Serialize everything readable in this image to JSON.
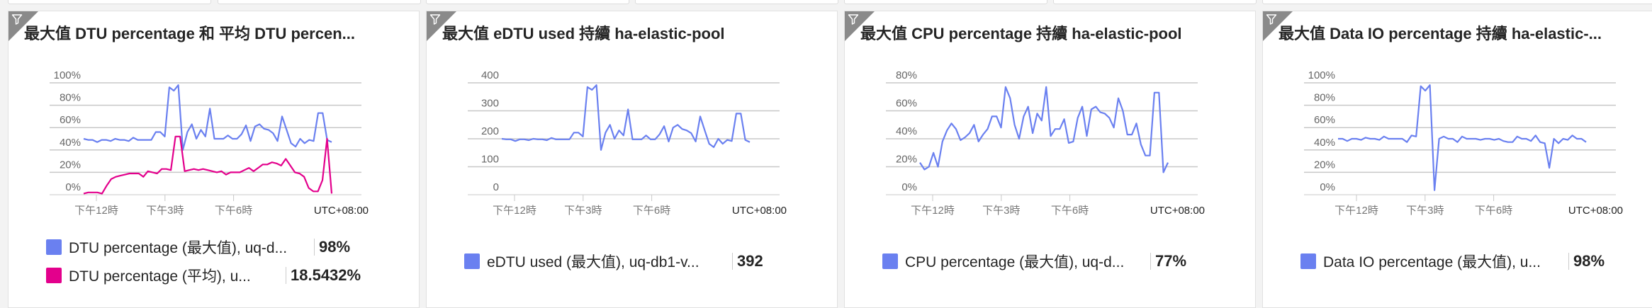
{
  "colors": {
    "blue": "#6a80f0",
    "magenta": "#e3008c",
    "grid": "#c8c8c8"
  },
  "panels": [
    {
      "title": "最大值 DTU percentage 和 平均 DTU percen...",
      "filter_icon": "funnel-icon",
      "chart_data": {
        "type": "line",
        "title": "最大值 DTU percentage 和 平均 DTU percen...",
        "ylim": [
          0,
          100
        ],
        "y_ticks": [
          {
            "v": 0,
            "label": "0%"
          },
          {
            "v": 20,
            "label": "20%"
          },
          {
            "v": 40,
            "label": "40%"
          },
          {
            "v": 60,
            "label": "60%"
          },
          {
            "v": 80,
            "label": "80%"
          },
          {
            "v": 100,
            "label": "100%"
          }
        ],
        "x_ticks": [
          {
            "pos": 0.15,
            "label": "下午12時"
          },
          {
            "pos": 0.37,
            "label": "下午3時"
          },
          {
            "pos": 0.59,
            "label": "下午6時"
          }
        ],
        "timezone": "UTC+08:00",
        "series": [
          {
            "name": "DTU percentage (最大值), uq-d...",
            "color": "#6a80f0",
            "summary": "98%",
            "values": [
              50,
              49,
              49,
              47,
              49,
              49,
              48,
              50,
              49,
              49,
              48,
              51,
              49,
              49,
              49,
              49,
              56,
              56,
              52,
              96,
              93,
              98,
              40,
              56,
              63,
              50,
              58,
              52,
              77,
              50,
              50,
              50,
              53,
              50,
              50,
              54,
              62,
              48,
              61,
              63,
              59,
              58,
              55,
              48,
              70,
              58,
              46,
              43,
              50,
              46,
              49,
              48,
              73,
              73,
              49,
              47
            ]
          },
          {
            "name": "DTU percentage (平均), u...",
            "color": "#e3008c",
            "summary": "18.5432%",
            "values": [
              1,
              2,
              2,
              2,
              1,
              8,
              14,
              16,
              17,
              18,
              19,
              19,
              19,
              16,
              21,
              20,
              19,
              23,
              23,
              22,
              52,
              52,
              21,
              22,
              23,
              22,
              23,
              22,
              21,
              20,
              21,
              18,
              20,
              20,
              20,
              22,
              24,
              21,
              24,
              27,
              27,
              29,
              28,
              26,
              32,
              26,
              20,
              19,
              16,
              6,
              3,
              3,
              13,
              50,
              1
            ]
          }
        ]
      }
    },
    {
      "title": "最大值 eDTU used 持續 ha-elastic-pool",
      "filter_icon": "funnel-icon",
      "chart_data": {
        "type": "line",
        "title": "最大值 eDTU used 持續 ha-elastic-pool",
        "ylim": [
          0,
          400
        ],
        "y_ticks": [
          {
            "v": 0,
            "label": "0"
          },
          {
            "v": 100,
            "label": "100"
          },
          {
            "v": 200,
            "label": "200"
          },
          {
            "v": 300,
            "label": "300"
          },
          {
            "v": 400,
            "label": "400"
          }
        ],
        "x_ticks": [
          {
            "pos": 0.15,
            "label": "下午12時"
          },
          {
            "pos": 0.37,
            "label": "下午3時"
          },
          {
            "pos": 0.59,
            "label": "下午6時"
          }
        ],
        "timezone": "UTC+08:00",
        "series": [
          {
            "name": "eDTU used (最大值), uq-db1-v...",
            "color": "#6a80f0",
            "summary": "392",
            "values": [
              200,
              198,
              198,
              192,
              198,
              198,
              195,
              200,
              198,
              198,
              195,
              203,
              198,
              198,
              198,
              198,
              222,
              222,
              208,
              385,
              375,
              392,
              160,
              222,
              250,
              200,
              230,
              212,
              305,
              198,
              198,
              198,
              212,
              198,
              198,
              216,
              245,
              190,
              240,
              250,
              235,
              230,
              220,
              190,
              280,
              230,
              182,
              170,
              200,
              182,
              196,
              192,
              290,
              290,
              196,
              188
            ]
          }
        ]
      }
    },
    {
      "title": "最大值 CPU percentage 持續 ha-elastic-pool",
      "filter_icon": "funnel-icon",
      "chart_data": {
        "type": "line",
        "title": "最大值 CPU percentage 持續 ha-elastic-pool",
        "ylim": [
          0,
          80
        ],
        "y_ticks": [
          {
            "v": 0,
            "label": "0%"
          },
          {
            "v": 20,
            "label": "20%"
          },
          {
            "v": 40,
            "label": "40%"
          },
          {
            "v": 60,
            "label": "60%"
          },
          {
            "v": 80,
            "label": "80%"
          }
        ],
        "x_ticks": [
          {
            "pos": 0.15,
            "label": "下午12時"
          },
          {
            "pos": 0.37,
            "label": "下午3時"
          },
          {
            "pos": 0.59,
            "label": "下午6時"
          }
        ],
        "timezone": "UTC+08:00",
        "series": [
          {
            "name": "CPU percentage (最大值), uq-d...",
            "color": "#6a80f0",
            "summary": "77%",
            "values": [
              23,
              18,
              20,
              30,
              20,
              38,
              46,
              51,
              47,
              39,
              41,
              44,
              50,
              38,
              43,
              47,
              56,
              56,
              48,
              77,
              69,
              50,
              40,
              56,
              63,
              44,
              58,
              53,
              77,
              42,
              47,
              47,
              54,
              37,
              38,
              55,
              63,
              42,
              61,
              63,
              59,
              58,
              55,
              48,
              69,
              60,
              43,
              43,
              51,
              36,
              28,
              28,
              73,
              73,
              16,
              23
            ]
          }
        ]
      }
    },
    {
      "title": "最大值 Data IO percentage 持續 ha-elastic-...",
      "filter_icon": "funnel-icon",
      "chart_data": {
        "type": "line",
        "title": "最大值 Data IO percentage 持續 ha-elastic-...",
        "ylim": [
          0,
          100
        ],
        "y_ticks": [
          {
            "v": 0,
            "label": "0%"
          },
          {
            "v": 20,
            "label": "20%"
          },
          {
            "v": 40,
            "label": "40%"
          },
          {
            "v": 60,
            "label": "60%"
          },
          {
            "v": 80,
            "label": "80%"
          },
          {
            "v": 100,
            "label": "100%"
          }
        ],
        "x_ticks": [
          {
            "pos": 0.15,
            "label": "下午12時"
          },
          {
            "pos": 0.37,
            "label": "下午3時"
          },
          {
            "pos": 0.59,
            "label": "下午6時"
          }
        ],
        "timezone": "UTC+08:00",
        "series": [
          {
            "name": "Data IO percentage (最大值), u...",
            "color": "#6a80f0",
            "summary": "98%",
            "values": [
              50,
              50,
              48,
              50,
              50,
              49,
              51,
              50,
              50,
              49,
              52,
              50,
              50,
              50,
              50,
              47,
              53,
              52,
              97,
              93,
              98,
              4,
              50,
              52,
              50,
              50,
              47,
              52,
              50,
              50,
              50,
              49,
              50,
              50,
              49,
              50,
              48,
              47,
              47,
              52,
              50,
              50,
              48,
              53,
              47,
              46,
              24,
              50,
              46,
              50,
              49,
              53,
              50,
              50,
              47
            ]
          }
        ]
      }
    }
  ]
}
